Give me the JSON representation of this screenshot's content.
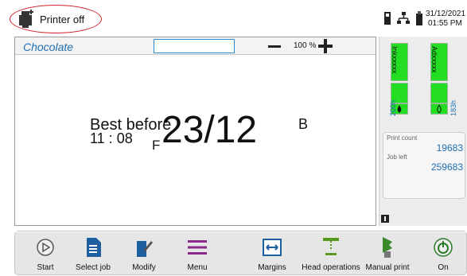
{
  "status": {
    "text": "Printer off"
  },
  "clock": {
    "date": "31/12/2021",
    "time": "01:55 PM"
  },
  "job": {
    "name": "Chocolate",
    "field_value": "",
    "zoom": "100 %"
  },
  "message": {
    "line1": "Best before",
    "line2": "11 : 08",
    "f_marker": "F",
    "date": "23/12",
    "b_marker": "B"
  },
  "ink": {
    "ink_label": "Inkxxxxx",
    "ink_hours": "200h",
    "additive_label": "Adxxxxx",
    "additive_hours": "183h"
  },
  "counters": {
    "print_count_label": "Print count",
    "print_count_value": "19683",
    "job_left_label": "Job left",
    "job_left_value": "259683"
  },
  "toolbar": {
    "items": [
      {
        "label": "Start",
        "icon": "play-icon"
      },
      {
        "label": "Select job",
        "icon": "document-icon"
      },
      {
        "label": "Modify",
        "icon": "edit-icon"
      },
      {
        "label": "Menu",
        "icon": "menu-icon"
      },
      {
        "label": "Margins",
        "icon": "margins-icon"
      },
      {
        "label": "Head operations",
        "icon": "head-icon"
      },
      {
        "label": "Manual print",
        "icon": "manual-print-icon"
      },
      {
        "label": "On",
        "icon": "power-icon"
      }
    ]
  },
  "colors": {
    "accent": "#1e6fb3",
    "status_ring": "#d3202a",
    "ink_level": "#22dd22",
    "menu_purple": "#8a2a8a"
  }
}
